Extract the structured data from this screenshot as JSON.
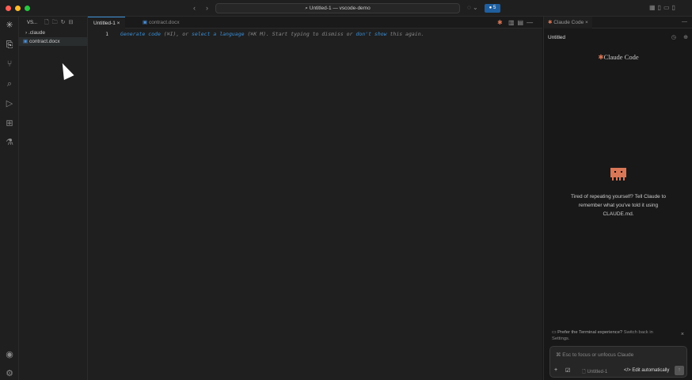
{
  "window": {
    "title": "Untitled-1 — vscode-demo",
    "account_badge": "● 5"
  },
  "explorer": {
    "title": "VS...",
    "items": [
      {
        "label": ".claude",
        "type": "folder"
      },
      {
        "label": "contract.docx",
        "type": "file"
      }
    ]
  },
  "editor": {
    "tabs": [
      {
        "label": "Untitled-1",
        "active": true
      },
      {
        "label": "contract.docx",
        "active": false
      }
    ],
    "line_number": "1",
    "hint": {
      "p1": "Generate code",
      "p2": " (⌘I), or ",
      "p3": "select a language",
      "p4": " (⌘K M). Start typing to dismiss or ",
      "p5": "don't show",
      "p6": " this again."
    }
  },
  "claude": {
    "tab_label": "Claude Code",
    "session_title": "Untitled",
    "logo_text": "Claude Code",
    "tip": "Tired of repeating yourself? Tell Claude to remember what you've told it using CLAUDE.md.",
    "notice": "Prefer the Terminal experience?",
    "notice_link": "Switch back in Settings.",
    "input_placeholder": "⌘ Esc to focus or unfocus Claude",
    "file_chip": "Untitled-1",
    "mode": "Edit automatically"
  },
  "colors": {
    "accent": "#d97757",
    "link": "#3b8fd6"
  }
}
